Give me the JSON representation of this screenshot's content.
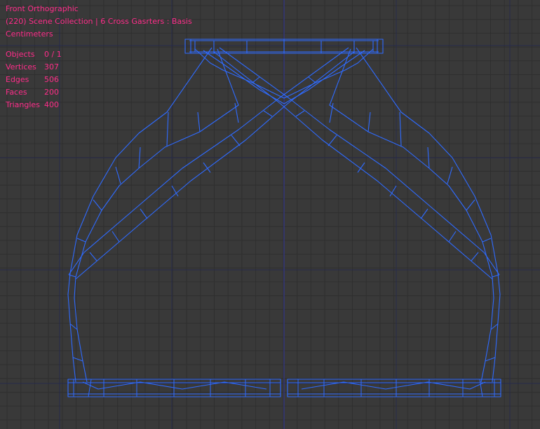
{
  "viewport": {
    "view_name": "Front Orthographic",
    "collection_line": "(220) Scene Collection | 6 Cross Gasrters : Basis",
    "units": "Centimeters",
    "stats": [
      {
        "label": "Objects",
        "value": "0 / 1"
      },
      {
        "label": "Vertices",
        "value": "307"
      },
      {
        "label": "Edges",
        "value": "506"
      },
      {
        "label": "Faces",
        "value": "200"
      },
      {
        "label": "Triangles",
        "value": "400"
      }
    ]
  },
  "colors": {
    "background": "#393939",
    "grid_minor": "#2f2f2f",
    "grid_major": "#262a4a",
    "axis": "#34388c",
    "wire": "#2f6bff",
    "hud_text": "#ff2d8a"
  }
}
